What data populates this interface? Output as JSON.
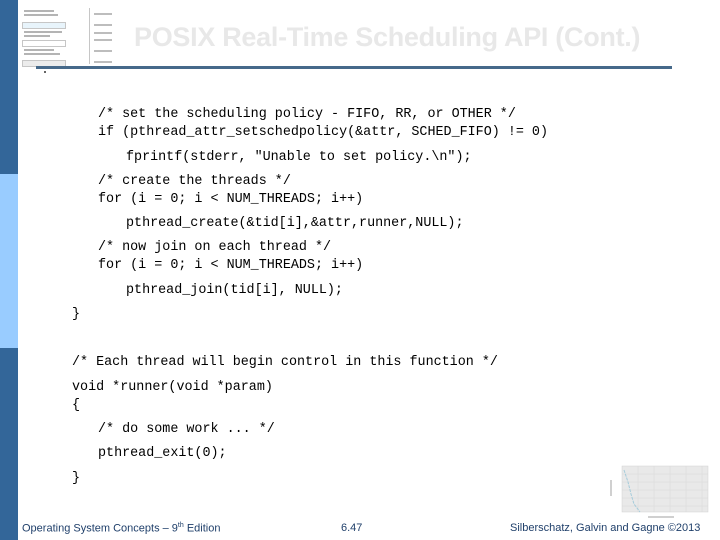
{
  "slide": {
    "title": "POSIX Real-Time Scheduling API (Cont.)",
    "code_lines": [
      "/* set the scheduling policy - FIFO, RR, or OTHER */",
      "if (pthread_attr_setschedpolicy(&attr, SCHED_FIFO) != 0)",
      "fprintf(stderr, \"Unable to set policy.\\n\");",
      "/* create the threads */",
      "for (i = 0; i < NUM_THREADS; i++)",
      "pthread_create(&tid[i],&attr,runner,NULL);",
      "/* now join on each thread */",
      "for (i = 0; i < NUM_THREADS; i++)",
      "pthread_join(tid[i], NULL);",
      "}",
      "/* Each thread will begin control in this function */",
      "void *runner(void *param)",
      "{",
      "/* do some work ... */",
      "pthread_exit(0);",
      "}"
    ]
  },
  "footer": {
    "book": "Operating System Concepts – 9",
    "book_sup": "th",
    "book_suffix": " Edition",
    "page": "6.47",
    "copyright": "Silberschatz, Galvin and Gagne ©2013"
  },
  "colors": {
    "sidebar": "#336699",
    "sidebar_band": "#99ccff",
    "title_rule": "#46698a",
    "title_text": "#e8e8e8",
    "footer_text": "#1f3f6a"
  }
}
